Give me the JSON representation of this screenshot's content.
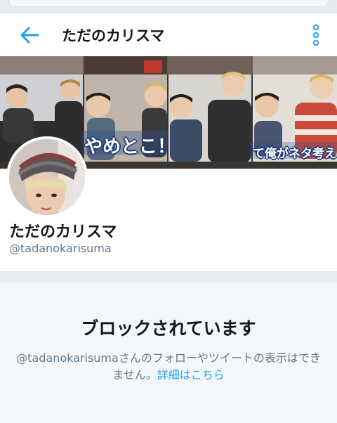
{
  "header": {
    "title": "ただのカリスマ",
    "back_icon": "arrow-left-icon",
    "more_icon": "vertical-ellipsis-icon"
  },
  "banner": {
    "caption_left": "やめとこ！",
    "caption_right": "て俺がネタ考え"
  },
  "profile": {
    "name": "ただのカリスマ",
    "handle": "@tadanokarisuma"
  },
  "blocked": {
    "title": "ブロックされています",
    "description": "@tadanokarisumaさんのフォローやツイートの表示はできません。",
    "link_text": "詳細はこちら"
  },
  "colors": {
    "accent": "#1da1f2",
    "secondary_text": "#657786",
    "separator": "#e6ecf0"
  }
}
